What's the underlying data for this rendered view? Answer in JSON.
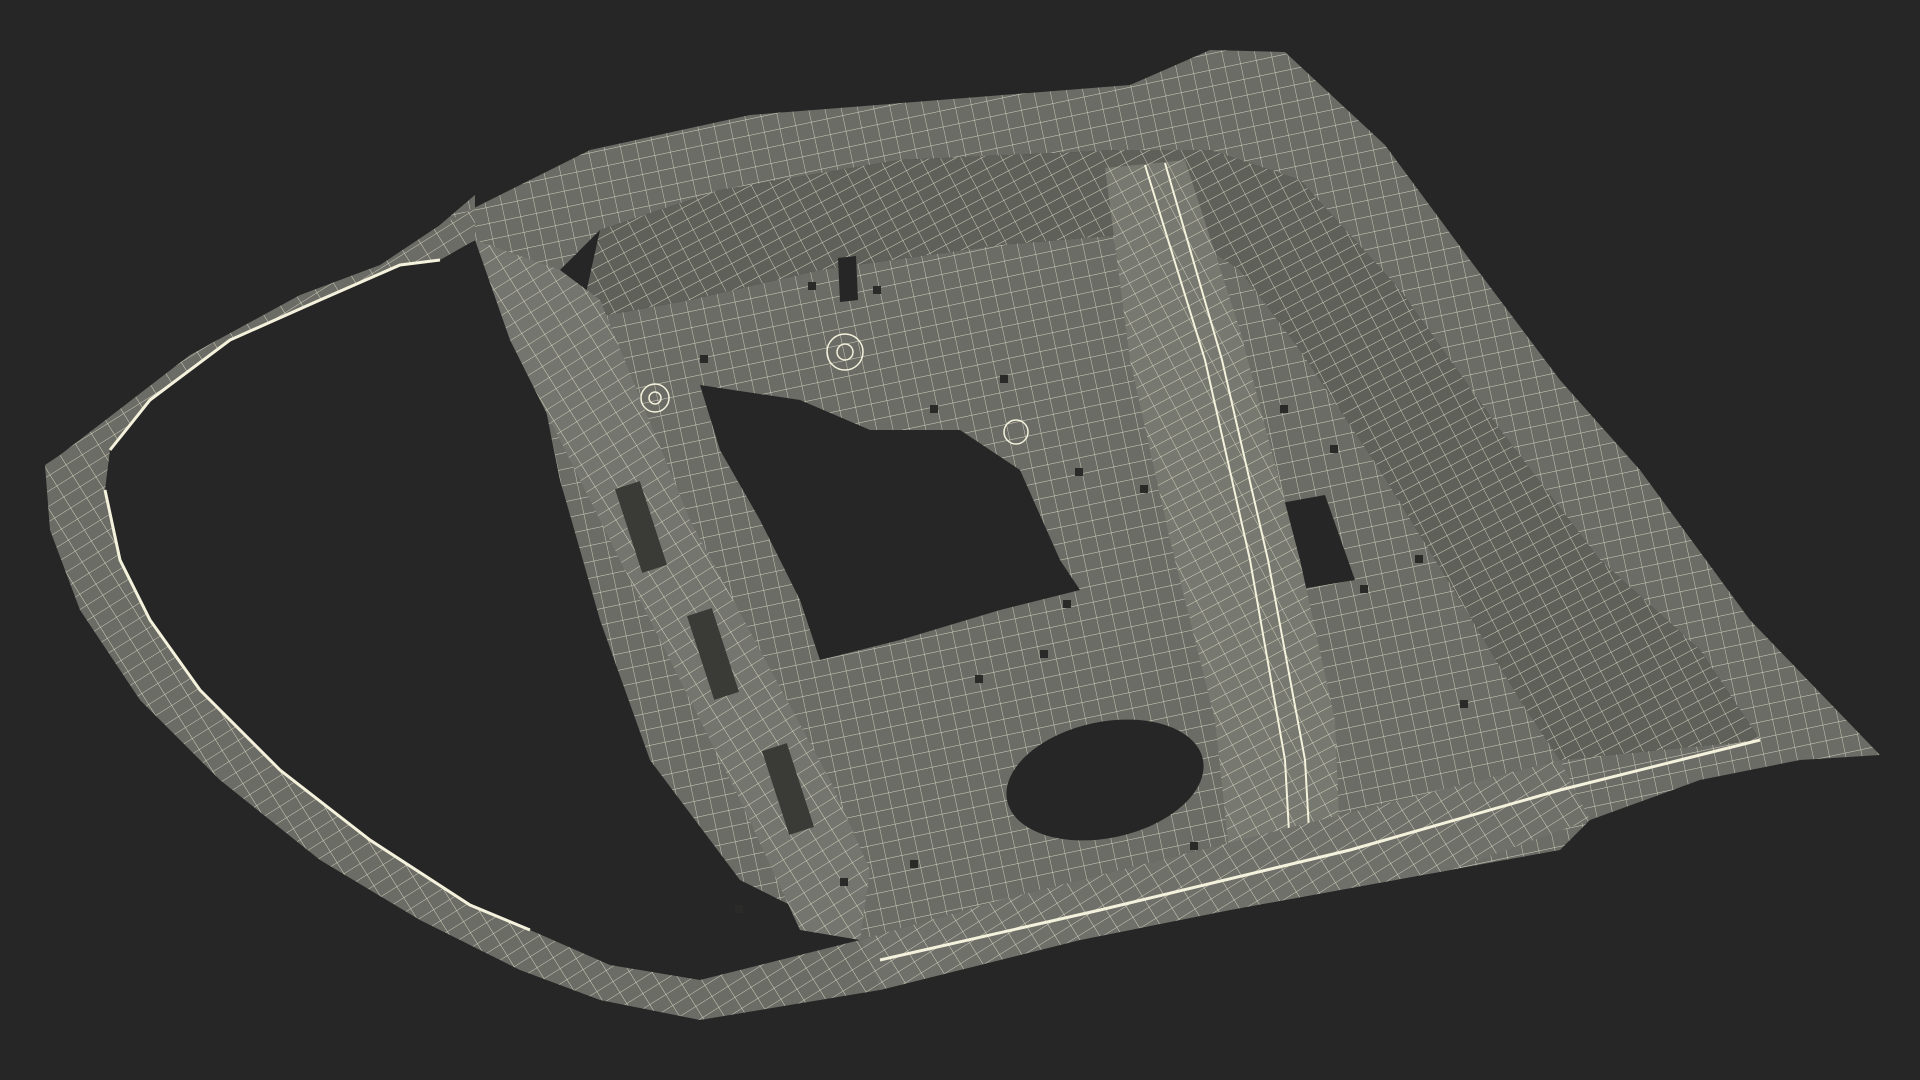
{
  "scene": {
    "subject": "car-door-inner-panel-wireframe",
    "background_color": "#262626",
    "surface_color": "#6b6c66",
    "surface_shade_color": "#5a5b55",
    "surface_light_color": "#7a7b74",
    "wire_color": "#e6e4cf"
  }
}
